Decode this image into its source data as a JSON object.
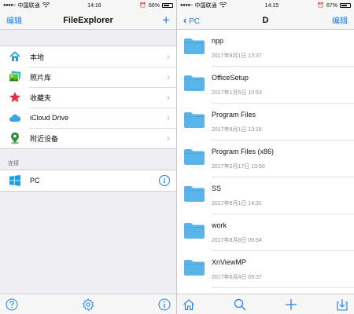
{
  "left": {
    "status": {
      "carrier": "中国联通",
      "time": "14:16",
      "battery": "66%",
      "battery_level": 0.66
    },
    "nav": {
      "edit": "编辑",
      "title": "FileExplorer",
      "add": "+"
    },
    "locations": [
      {
        "label": "本地",
        "icon": "home-icon"
      },
      {
        "label": "照片库",
        "icon": "photos-icon"
      },
      {
        "label": "收藏夹",
        "icon": "star-icon"
      },
      {
        "label": "iCloud Drive",
        "icon": "cloud-icon"
      },
      {
        "label": "附近设备",
        "icon": "location-pin-icon"
      }
    ],
    "devices_header": "连接",
    "devices": [
      {
        "label": "PC",
        "icon": "windows-icon",
        "info": "i"
      }
    ],
    "tabbar": [
      "help-icon",
      "settings-icon",
      "info-icon"
    ]
  },
  "right": {
    "status": {
      "carrier": "中国联通",
      "time": "14:15",
      "battery": "67%",
      "battery_level": 0.67
    },
    "nav": {
      "back": "PC",
      "title": "D",
      "edit": "编辑"
    },
    "files": [
      {
        "name": "npp",
        "date": "2017年8月1日 13:37"
      },
      {
        "name": "OfficeSetup",
        "date": "2017年1月5日 10:53"
      },
      {
        "name": "Program Files",
        "date": "2017年8月1日 13:16"
      },
      {
        "name": "Program Files (x86)",
        "date": "2017年2月17日 13:50"
      },
      {
        "name": "SS",
        "date": "2017年8月1日 14:31"
      },
      {
        "name": "work",
        "date": "2017年8月8日 09:54"
      },
      {
        "name": "XnViewMP",
        "date": "2017年8月4日 09:37"
      }
    ],
    "tabbar": [
      "home-icon",
      "search-icon",
      "add-icon",
      "download-icon"
    ]
  },
  "colors": {
    "accent": "#1a7cf2",
    "folder": "#5ab4ea"
  }
}
